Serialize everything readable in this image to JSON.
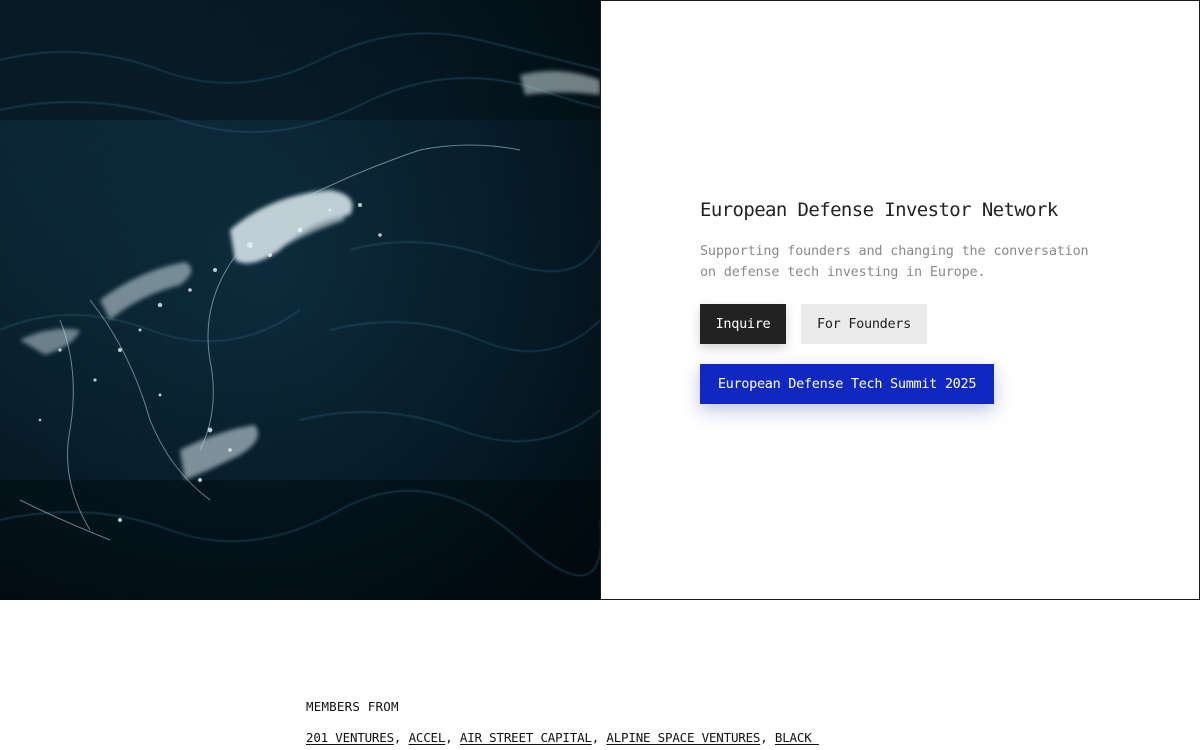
{
  "hero": {
    "image_description_icon": "ocean-waves-image",
    "title": "European Defense Investor Network",
    "subtitle": "Supporting founders and changing the conversation on defense tech investing in Europe.",
    "buttons": {
      "inquire": "Inquire",
      "founders": "For Founders",
      "summit": "European Defense Tech Summit 2025"
    }
  },
  "members": {
    "heading": "MEMBERS FROM",
    "items": [
      "201 VENTURES",
      "ACCEL",
      "AIR STREET CAPITAL",
      "ALPINE SPACE VENTURES",
      "BLACK "
    ],
    "separator": ", "
  },
  "colors": {
    "accent_blue": "#1028c0",
    "dark_button": "#222222",
    "light_button": "#ebebeb",
    "ocean_dark": "#02121c"
  }
}
